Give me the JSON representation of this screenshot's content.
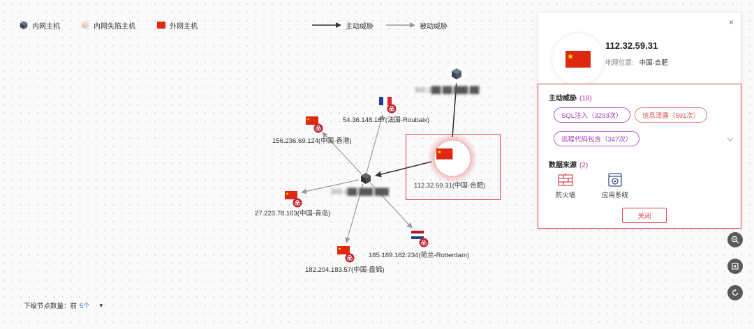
{
  "legend": {
    "internal_host": "内网主机",
    "honeypot_host": "内网失陷主机",
    "external_host": "外网主机",
    "active_threat": "主动威胁",
    "passive_threat": "被动威胁"
  },
  "graph": {
    "center_label": "202.1██.███.███",
    "top_label": "202.1██.██.███.██",
    "selected_label": "112.32.59.31(中国-合肥)",
    "nodes": [
      {
        "id": "fr",
        "label": "54.36.148.167(法国-Roubaix)",
        "flag": "france"
      },
      {
        "id": "hk",
        "label": "156.236.69.124(中国-香港)",
        "flag": "china"
      },
      {
        "id": "qd",
        "label": "27.223.78.163(中国-青岛)",
        "flag": "china"
      },
      {
        "id": "sh",
        "label": "182.204.183.57(中国-盘锦)",
        "flag": "china"
      },
      {
        "id": "nl",
        "label": "185.189.182.234(荷兰-Rotterdam)",
        "flag": "netherlands"
      }
    ]
  },
  "panel": {
    "ip": "112.32.59.31",
    "location_key": "地理位置:",
    "location_value": "中国-合肥",
    "active_threat_title": "主动威胁",
    "active_threat_count": "(18)",
    "chips": [
      {
        "label": "SQL注入（3293次）",
        "style": "purple"
      },
      {
        "label": "信息泄露（591次）",
        "style": "red"
      },
      {
        "label": "远程代码包含（347次）",
        "style": "purple"
      }
    ],
    "source_title": "数据来源",
    "source_count": "(2)",
    "sources": [
      {
        "label": "防火墙",
        "icon": "firewall-icon"
      },
      {
        "label": "应用系统",
        "icon": "app-system-icon"
      }
    ],
    "close_label": "关闭",
    "x_glyph": "×"
  },
  "footer": {
    "label": "下级节点数量：前",
    "value": "5个",
    "caret": "▼"
  },
  "colors": {
    "accent_red": "#d64545",
    "chip_purple": "#9a3fb3",
    "link_blue": "#3a7bd5",
    "edge_gray": "#9a9a9a",
    "edge_dark": "#333333"
  }
}
